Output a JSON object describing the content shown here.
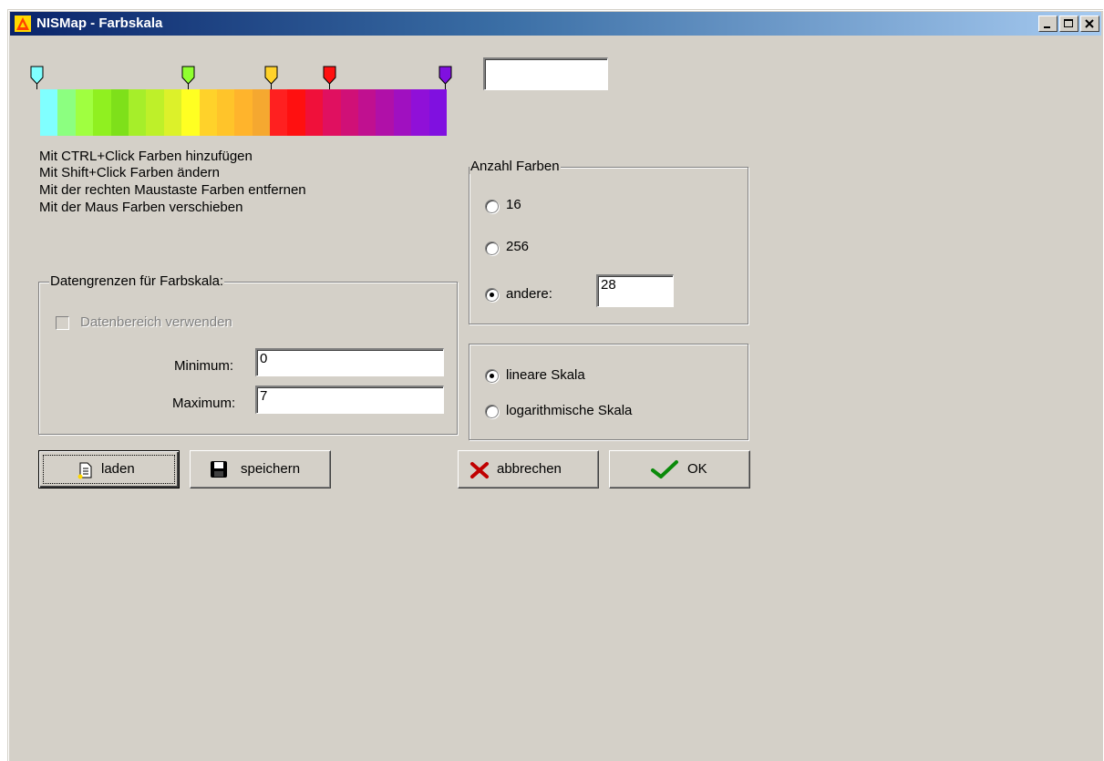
{
  "window": {
    "title": "NISMap - Farbskala"
  },
  "colorscale": {
    "value": "",
    "segments": [
      "#80ffff",
      "#8cff80",
      "#a0ff40",
      "#90f020",
      "#7ee01a",
      "#a6ee2a",
      "#bef029",
      "#dcf12a",
      "#ffff22",
      "#ffd22a",
      "#ffc42a",
      "#ffb42c",
      "#f5a830",
      "#ff2020",
      "#ff1010",
      "#f0103a",
      "#e01060",
      "#d01077",
      "#c01090",
      "#b010a8",
      "#a010c0",
      "#9010d8",
      "#8010e0"
    ],
    "markers": [
      {
        "color": "#80ffff",
        "name": "marker-cyan"
      },
      {
        "color": "#90ff30",
        "name": "marker-green"
      },
      {
        "color": "#ffd22a",
        "name": "marker-yellow"
      },
      {
        "color": "#ff1010",
        "name": "marker-red"
      },
      {
        "color": "#8010e0",
        "name": "marker-violet"
      }
    ]
  },
  "help": {
    "line1": "Mit CTRL+Click Farben hinzufügen",
    "line2": "Mit Shift+Click Farben ändern",
    "line3": "Mit der rechten Maustaste Farben entfernen",
    "line4": "Mit der Maus Farben verschieben"
  },
  "limits": {
    "legend": "Datengrenzen für Farbskala:",
    "checkbox_label": "Datenbereich verwenden",
    "min_label": "Minimum:",
    "min_value": "0",
    "max_label": "Maximum:",
    "max_value": "7"
  },
  "colors_count": {
    "legend": "Anzahl Farben",
    "opt16": "16",
    "opt256": "256",
    "other_label": "andere:",
    "other_value": "28"
  },
  "scale_type": {
    "linear": "lineare Skala",
    "log": "logarithmische Skala"
  },
  "buttons": {
    "load": "laden",
    "save": "speichern",
    "cancel": "abbrechen",
    "ok": "OK"
  }
}
